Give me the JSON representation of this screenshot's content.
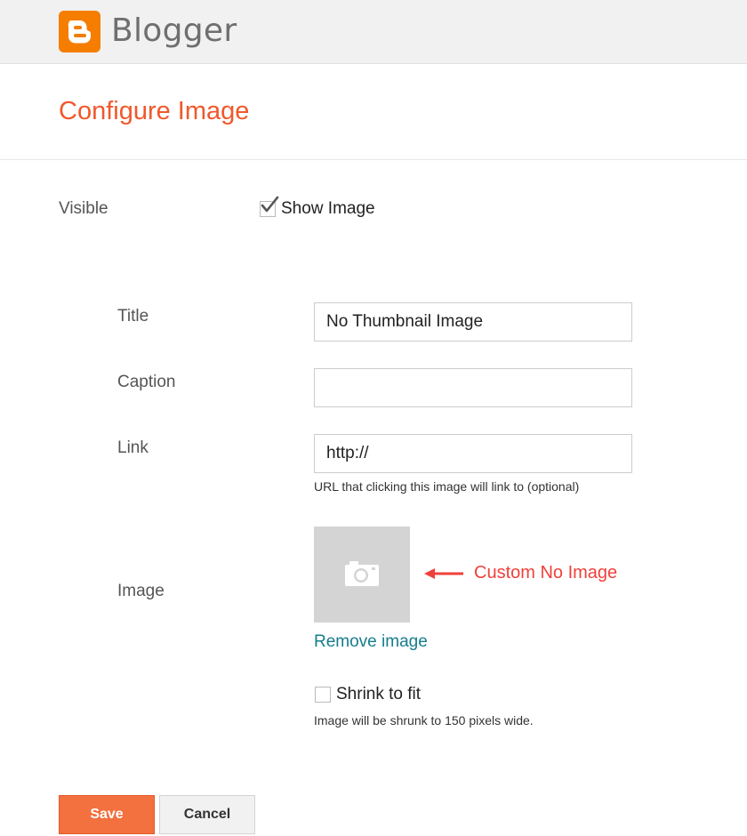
{
  "header": {
    "brand": "Blogger",
    "icon": "blogger-logo-icon",
    "brand_color": "#f57d00"
  },
  "page": {
    "title": "Configure Image",
    "accent_color": "#f0582b"
  },
  "visible": {
    "label": "Visible",
    "option_label": "Show Image",
    "checked": true
  },
  "fields": {
    "title": {
      "label": "Title",
      "value": "No Thumbnail Image"
    },
    "caption": {
      "label": "Caption",
      "value": ""
    },
    "link": {
      "label": "Link",
      "value": "http://",
      "hint": "URL that clicking this image will link to (optional)"
    }
  },
  "image": {
    "label": "Image",
    "placeholder_icon": "camera-icon",
    "annotation": "Custom No Image",
    "annotation_color": "#f0403a",
    "remove_label": "Remove image"
  },
  "shrink": {
    "label": "Shrink to fit",
    "checked": false,
    "hint": "Image will be shrunk to 150 pixels wide."
  },
  "buttons": {
    "save": "Save",
    "cancel": "Cancel"
  }
}
